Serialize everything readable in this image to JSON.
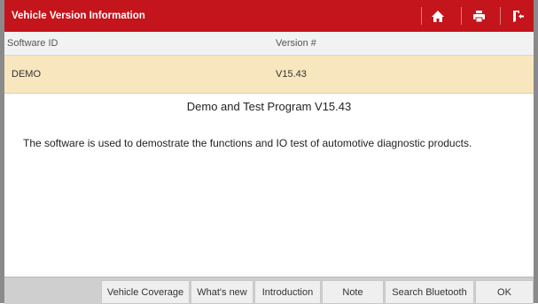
{
  "window": {
    "title": "Vehicle Version Information"
  },
  "toolbar": {
    "home_icon": "home-icon",
    "print_icon": "printer-icon",
    "exit_icon": "exit-icon"
  },
  "table": {
    "headers": [
      "Software ID",
      "Version #"
    ],
    "rows": [
      [
        "DEMO",
        "V15.43"
      ]
    ]
  },
  "content": {
    "heading": "Demo and Test Program V15.43",
    "description": "The software is used to demostrate the functions and IO test of automotive diagnostic products."
  },
  "footer": {
    "buttons": [
      "Vehicle Coverage",
      "What's new",
      "Introduction",
      "Note",
      "Search Bluetooth",
      "OK"
    ]
  },
  "colors": {
    "title_bar": "#c4141c",
    "selected_row": "#f8e6be",
    "side_border": "#8a8a8a"
  }
}
